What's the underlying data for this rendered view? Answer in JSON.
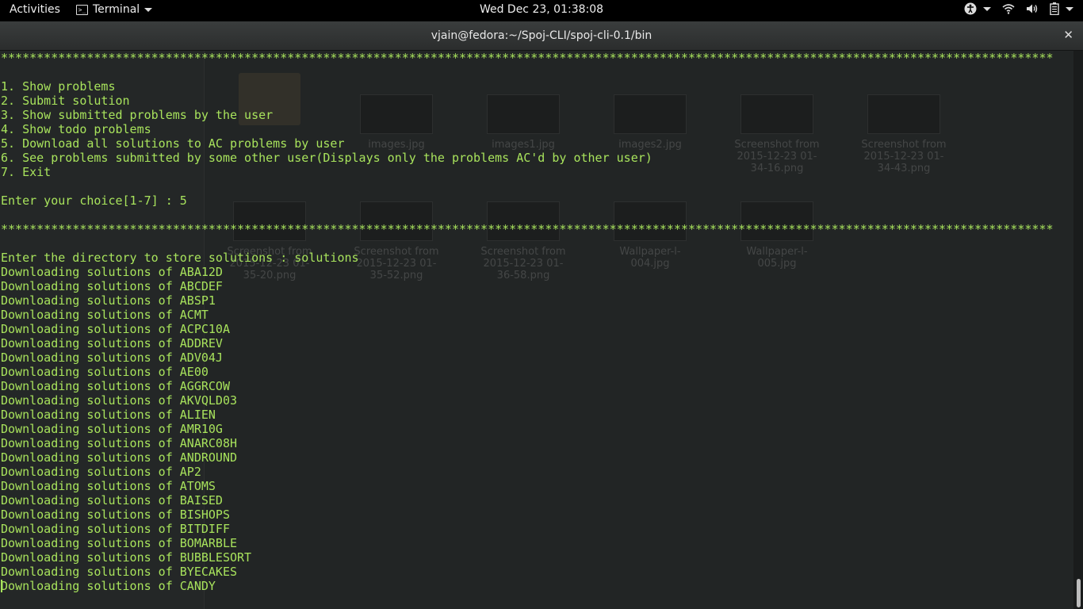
{
  "topbar": {
    "activities": "Activities",
    "app_name": "Terminal",
    "clock": "Wed Dec 23, 01:38:08",
    "icons": [
      "accessibility-icon",
      "wifi-icon",
      "volume-icon",
      "battery-icon"
    ]
  },
  "window": {
    "title": "vjain@fedora:~/Spoj-CLI/spoj-cli-0.1/bin",
    "close_glyph": "✕"
  },
  "terminal": {
    "fg_color": "#a8e35c",
    "bg_color": "#222525",
    "lines": [
      "***************************************************************************************************************************************************",
      "",
      "1. Show problems",
      "2. Submit solution",
      "3. Show submitted problems by the user",
      "4. Show todo problems",
      "5. Download all solutions to AC problems by user",
      "6. See problems submitted by some other user(Displays only the problems AC'd by other user)",
      "7. Exit",
      "",
      "Enter your choice[1-7] : 5",
      "",
      "***************************************************************************************************************************************************",
      "",
      "Enter the directory to store solutions : solutions",
      "Downloading solutions of ABA12D",
      "Downloading solutions of ABCDEF",
      "Downloading solutions of ABSP1",
      "Downloading solutions of ACMT",
      "Downloading solutions of ACPC10A",
      "Downloading solutions of ADDREV",
      "Downloading solutions of ADV04J",
      "Downloading solutions of AE00",
      "Downloading solutions of AGGRCOW",
      "Downloading solutions of AKVQLD03",
      "Downloading solutions of ALIEN",
      "Downloading solutions of AMR10G",
      "Downloading solutions of ANARC08H",
      "Downloading solutions of ANDROUND",
      "Downloading solutions of AP2",
      "Downloading solutions of ATOMS",
      "Downloading solutions of BAISED",
      "Downloading solutions of BISHOPS",
      "Downloading solutions of BITDIFF",
      "Downloading solutions of BOMARBLE",
      "Downloading solutions of BUBBLESORT",
      "Downloading solutions of BYECAKES",
      "Downloading solutions of CANDY"
    ]
  },
  "background_files": [
    {
      "name": "images.jpg"
    },
    {
      "name": "images1.jpg"
    },
    {
      "name": "images2.jpg"
    },
    {
      "name": "Screenshot from 2015-12-23 01-34-16.png"
    },
    {
      "name": "Screenshot from 2015-12-23 01-34-43.png"
    },
    {
      "name": "Screenshot from 2015-12-23 01-35-20.png"
    },
    {
      "name": "Screenshot from 2015-12-23 01-35-52.png"
    },
    {
      "name": "Screenshot from 2015-12-23 01-36-58.png"
    },
    {
      "name": "Wallpaper-l-004.jpg"
    },
    {
      "name": "Wallpaper-l-005.jpg"
    }
  ]
}
